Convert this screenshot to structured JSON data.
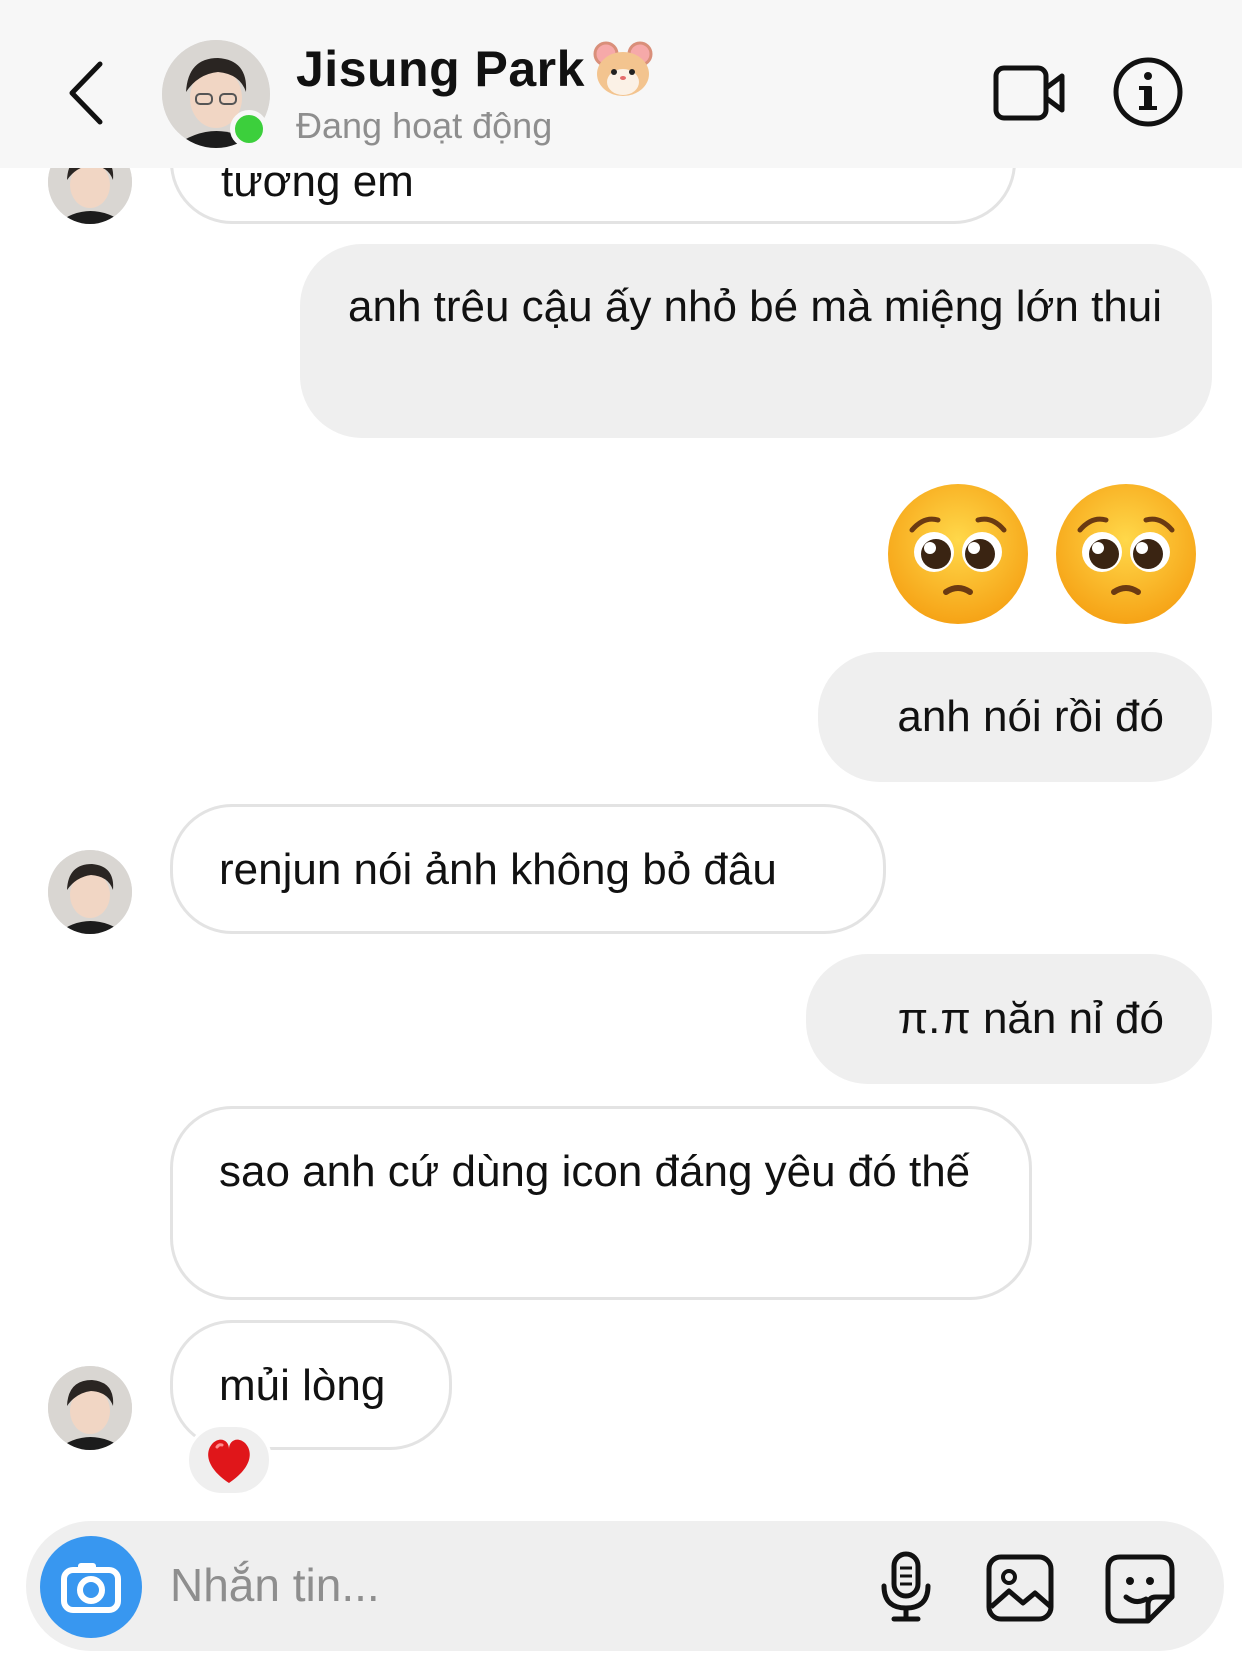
{
  "header": {
    "contact_name": "Jisung Park",
    "name_emoji": "hamster-face",
    "status": "Đang hoạt động",
    "status_color": "#3ccf3c"
  },
  "messages": {
    "partial_top": "tương em",
    "m1": "anh trêu cậu ấy nhỏ bé mà miệng lớn thui",
    "m2_emoji": "🥺🥺",
    "m3": "anh nói rồi đó",
    "m4": "renjun nói ảnh không bỏ đâu",
    "m5": "π.π năn nỉ đó",
    "m6": "sao anh cứ dùng icon đáng yêu đó thế",
    "m7": "mủi lòng",
    "m7_reaction": "❤️"
  },
  "composer": {
    "placeholder": "Nhắn tin..."
  },
  "colors": {
    "accent": "#3897f0",
    "outgoing_bubble": "#efefef",
    "incoming_border": "#e3e3e3"
  }
}
